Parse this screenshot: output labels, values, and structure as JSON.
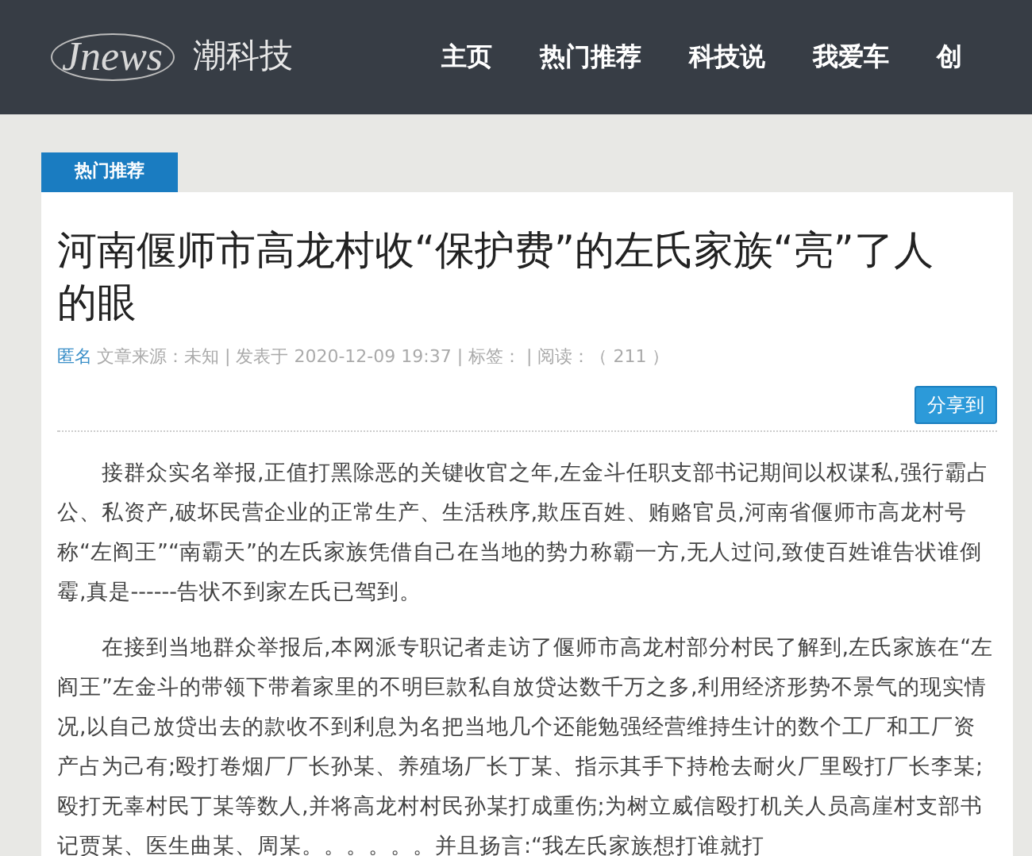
{
  "header": {
    "logo_mark": "Jnews",
    "site_name": "潮科技",
    "nav": [
      {
        "label": "主页"
      },
      {
        "label": "热门推荐"
      },
      {
        "label": "科技说"
      },
      {
        "label": "我爱车"
      },
      {
        "label": "创"
      }
    ]
  },
  "category_tag": "热门推荐",
  "article": {
    "title": "河南偃师市高龙村收“保护费”的左氏家族“亮”了人的眼",
    "author": "匿名",
    "meta": "文章来源：未知 | 发表于 2020-12-09 19:37 | 标签：  | 阅读：（  211  ）",
    "share_button": "分享到",
    "paragraphs": [
      "接群众实名举报,正值打黑除恶的关键收官之年,左金斗任职支部书记期间以权谋私,强行霸占公、私资产,破坏民营企业的正常生产、生活秩序,欺压百姓、贿赂官员,河南省偃师市高龙村号称“左阎王”“南霸天”的左氏家族凭借自己在当地的势力称霸一方,无人过问,致使百姓谁告状谁倒霉,真是------告状不到家左氏已驾到。",
      "在接到当地群众举报后,本网派专职记者走访了偃师市高龙村部分村民了解到,左氏家族在“左阎王”左金斗的带领下带着家里的不明巨款私自放贷达数千万之多,利用经济形势不景气的现实情况,以自己放贷出去的款收不到利息为名把当地几个还能勉强经营维持生计的数个工厂和工厂资产占为己有;殴打卷烟厂厂长孙某、养殖场厂长丁某、指示其手下持枪去耐火厂里殴打厂长李某;殴打无辜村民丁某等数人,并将高龙村村民孙某打成重伤;为树立威信殴打机关人员高崖村支部书记贾某、医生曲某、周某。。。。。。并且扬言:“我左氏家族想打谁就打"
    ]
  }
}
